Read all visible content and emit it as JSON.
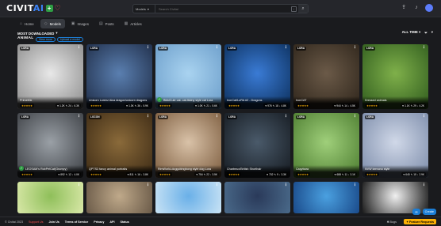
{
  "header": {
    "logo_text": "CIVIT",
    "logo_ai": "AI",
    "search_scope": "Models",
    "search_placeholder": "Search Civitai",
    "search_shortcut": "/"
  },
  "nav": {
    "tabs": [
      {
        "label": "Home",
        "icon": "home-icon",
        "glyph": "⌂",
        "active": false
      },
      {
        "label": "Models",
        "icon": "cube-icon",
        "glyph": "◇",
        "active": true
      },
      {
        "label": "Images",
        "icon": "image-icon",
        "glyph": "▣",
        "active": false
      },
      {
        "label": "Posts",
        "icon": "posts-icon",
        "glyph": "▤",
        "active": false
      },
      {
        "label": "Articles",
        "icon": "article-icon",
        "glyph": "▦",
        "active": false
      }
    ]
  },
  "toolbar": {
    "sort_label": "MOST DOWNLOADED",
    "period_label": "ALL TIME",
    "category": "ANIMAL",
    "chips": [
      "View more",
      "Upload a model"
    ]
  },
  "models": [
    {
      "title": "PrimeMix",
      "badge": "LORA",
      "dl": "6.3K",
      "likes": "1.2K",
      "comments": "24",
      "bg": [
        "#e8e8e8",
        "#8a8a8a"
      ],
      "verified": false
    },
    {
      "title": "Unicorn Lorenz Aina dragon/unicorn dragons",
      "badge": "LORA",
      "dl": "5.9K",
      "likes": "1.3K",
      "comments": "36",
      "bg": [
        "#5a7fb0",
        "#1d2a44"
      ],
      "verified": false
    },
    {
      "title": "BikkiCute cat- cat-Ikkiny style cat Lora",
      "badge": "LORA",
      "dl": "5.6K",
      "likes": "1.0K",
      "comments": "21",
      "bg": [
        "#a9d3f0",
        "#6a9cc9"
      ],
      "verified": true
    },
    {
      "title": "IronCat/LoRA #2 - Dragons",
      "badge": "LORA",
      "dl": "4.8K",
      "likes": "976",
      "comments": "18",
      "bg": [
        "#3a7bd5",
        "#0b2e5a"
      ],
      "verified": false
    },
    {
      "title": "IronCAT",
      "badge": "LORA",
      "dl": "4.5K",
      "likes": "944",
      "comments": "14",
      "bg": [
        "#6b5a48",
        "#2d241a"
      ],
      "verified": false
    },
    {
      "title": "Dressed animals",
      "badge": "LORA",
      "dl": "4.2K",
      "likes": "1.1K",
      "comments": "29",
      "bg": [
        "#7fb04a",
        "#2e5a1d"
      ],
      "verified": false
    },
    {
      "title": "LEOSAM's RobPetCat(Grumpy)",
      "badge": "LORA",
      "dl": "4.0K",
      "likes": "892",
      "comments": "12",
      "bg": [
        "#9aa0a6",
        "#3a3d42"
      ],
      "verified": true
    },
    {
      "title": "QPTS3 fancy animal portraits",
      "badge": "LOCON",
      "dl": "3.8K",
      "likes": "811",
      "comments": "16",
      "bg": [
        "#8a6a3a",
        "#3b2914"
      ],
      "verified": false
    },
    {
      "title": "RimWorld-doggobingbong style dog Lora",
      "badge": "LORA",
      "dl": "3.5K",
      "likes": "754",
      "comments": "22",
      "bg": [
        "#d9c2a8",
        "#7a5a3c"
      ],
      "verified": false
    },
    {
      "title": "Chartreux/British Shorthair",
      "badge": "LORA",
      "dl": "3.3K",
      "likes": "702",
      "comments": "9",
      "bg": [
        "#4a5a6a",
        "#14191f"
      ],
      "verified": false
    },
    {
      "title": "Capybara",
      "badge": "LORA",
      "dl": "3.1K",
      "likes": "688",
      "comments": "11",
      "bg": [
        "#9fcf7a",
        "#4a7a2e"
      ],
      "verified": false
    },
    {
      "title": "NVW kemono style",
      "badge": "LORA",
      "dl": "2.9K",
      "likes": "645",
      "comments": "15",
      "bg": [
        "#d0d8e8",
        "#7a8aa8"
      ],
      "verified": false
    },
    {
      "title": "",
      "badge": "",
      "dl": "",
      "likes": "",
      "comments": "",
      "bg": [
        "#8fbf5a",
        "#d9e8a8"
      ],
      "verified": false
    },
    {
      "title": "",
      "badge": "",
      "dl": "",
      "likes": "",
      "comments": "",
      "bg": [
        "#bfa98a",
        "#6a5a48"
      ],
      "verified": false
    },
    {
      "title": "",
      "badge": "",
      "dl": "",
      "likes": "",
      "comments": "",
      "bg": [
        "#6ab0e8",
        "#c9e3f5"
      ],
      "verified": false
    },
    {
      "title": "",
      "badge": "",
      "dl": "",
      "likes": "",
      "comments": "",
      "bg": [
        "#2a3a5a",
        "#4a6a8a"
      ],
      "verified": false
    },
    {
      "title": "",
      "badge": "",
      "dl": "",
      "likes": "",
      "comments": "",
      "bg": [
        "#4aa0e0",
        "#1a4a8a"
      ],
      "verified": false
    },
    {
      "title": "",
      "badge": "",
      "dl": "",
      "likes": "",
      "comments": "",
      "bg": [
        "#f0f0f0",
        "#1a1a1a"
      ],
      "verified": false
    }
  ],
  "footer": {
    "copyright": "© Civitai 2023",
    "support": "Support Us",
    "join": "Join Us",
    "terms": "Terms of Service",
    "privacy": "Privacy",
    "api": "API",
    "status": "Status",
    "bugs": "Bugs",
    "feature": "Feature Requests",
    "create": "Create"
  }
}
